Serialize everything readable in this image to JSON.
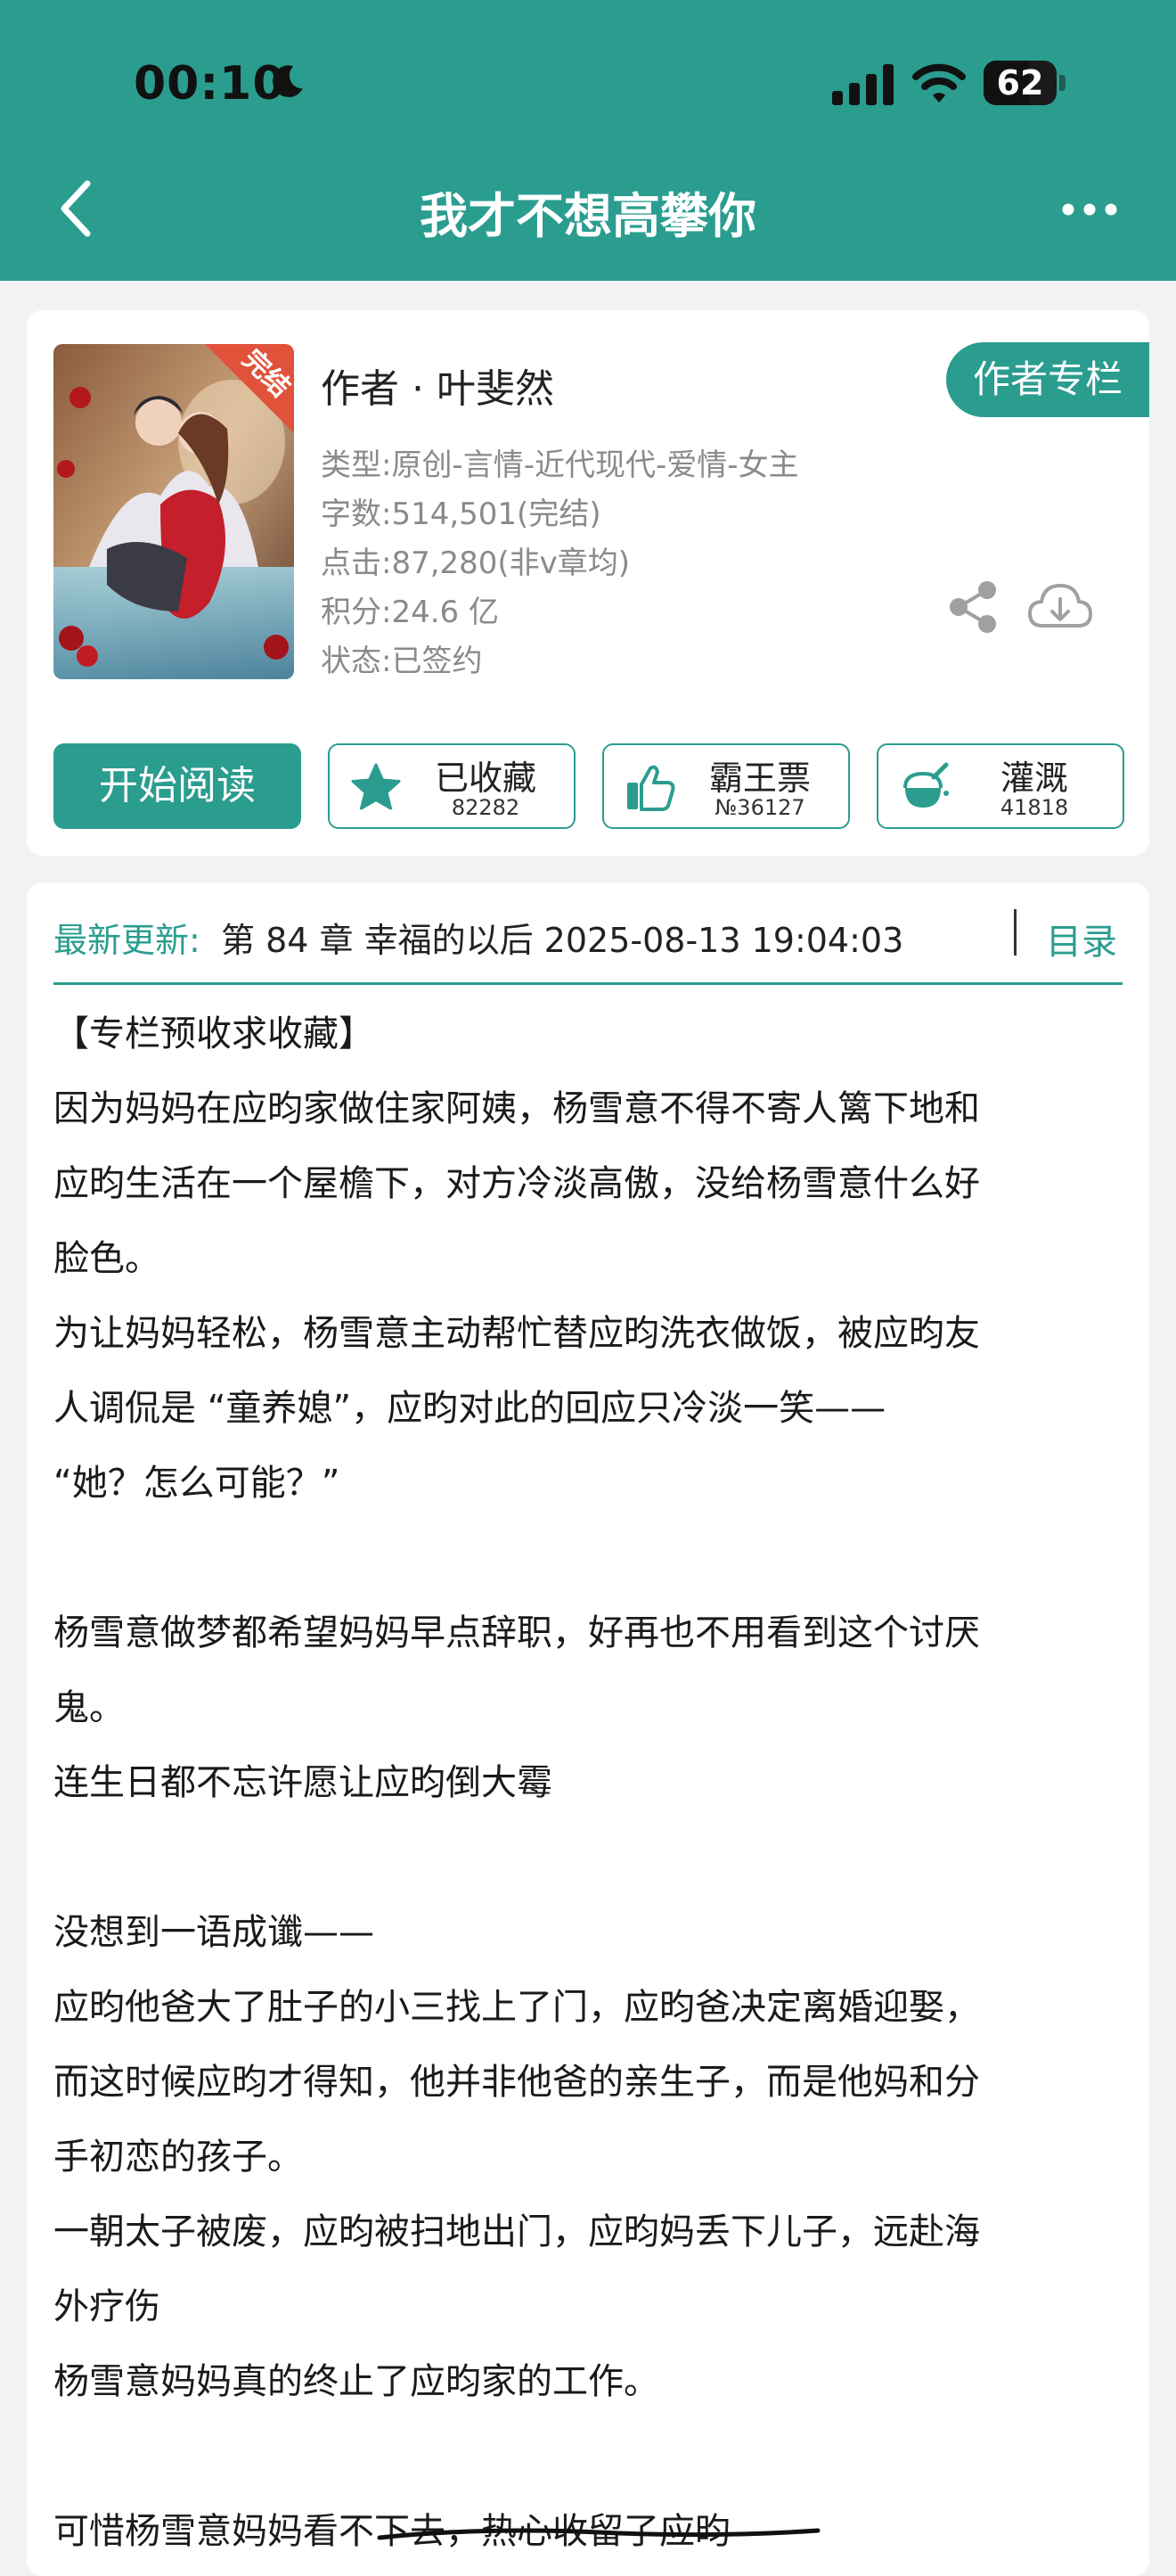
{
  "status_bar": {
    "time": "00:10",
    "battery": "62",
    "battery_level": 0.62
  },
  "header": {
    "title": "我才不想高攀你",
    "back_icon": "chevron-left-icon",
    "more_icon": "more-dots-icon"
  },
  "book": {
    "cover_badge": "完结",
    "author": "作者 · 叶斐然",
    "author_column_button": "作者专栏",
    "meta": [
      "类型:原创-言情-近代现代-爱情-女主",
      "字数:514,501(完结)",
      "点击:87,280(非v章均)",
      "积分:24.6 亿",
      "状态:已签约"
    ]
  },
  "actions": {
    "start_reading": "开始阅读",
    "buttons": [
      {
        "label": "已收藏",
        "count": "82282",
        "icon": "star-icon"
      },
      {
        "label": "霸王票",
        "count": "№36127",
        "icon": "thumbs-up-icon"
      },
      {
        "label": "灌溉",
        "count": "41818",
        "icon": "watering-flask-icon"
      }
    ]
  },
  "latest": {
    "label": "最新更新:",
    "text": "第 84 章 幸福的以后 2025-08-13 19:04:03",
    "toc": "目录"
  },
  "intro_lines": [
    "【专栏预收求收藏】",
    "因为妈妈在应昀家做住家阿姨，杨雪意不得不寄人篱下地和",
    "应昀生活在一个屋檐下，对方冷淡高傲，没给杨雪意什么好",
    "脸色。",
    "为让妈妈轻松，杨雪意主动帮忙替应昀洗衣做饭，被应昀友",
    "人调侃是 “童养媳”，应昀对此的回应只冷淡一笑——",
    "“她？怎么可能？”",
    "",
    "杨雪意做梦都希望妈妈早点辞职，好再也不用看到这个讨厌",
    "鬼。",
    "连生日都不忘许愿让应昀倒大霉",
    "",
    "没想到一语成谶——",
    "应昀他爸大了肚子的小三找上了门，应昀爸决定离婚迎娶，",
    "而这时候应昀才得知，他并非他爸的亲生子，而是他妈和分",
    "手初恋的孩子。",
    "一朝太子被废，应昀被扫地出门，应昀妈丢下儿子，远赴海",
    "外疗伤",
    "杨雪意妈妈真的终止了应昀家的工作。",
    "",
    "可惜杨雪意妈妈看不下去，热心收留了应昀"
  ],
  "colors": {
    "accent": "#2a9d8f",
    "card": "#ffffff",
    "page_bg": "#f2f2f4"
  }
}
